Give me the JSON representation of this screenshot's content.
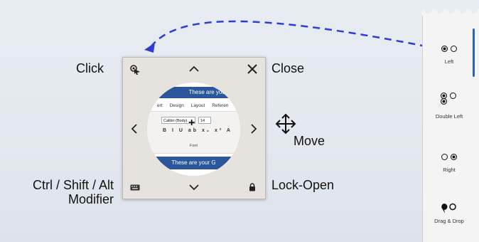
{
  "annotations": {
    "click": "Click",
    "close": "Close",
    "move": "Move",
    "modifier_line1": "Ctrl / Shift / Alt",
    "modifier_line2": "Modifier",
    "lock_open": "Lock-Open"
  },
  "panel": {
    "icons": {
      "click": "pointer-click-icon",
      "up": "chevron-up-icon",
      "close": "close-icon",
      "left": "chevron-left-icon",
      "right": "chevron-right-icon",
      "down": "chevron-down-icon",
      "keyboard": "keyboard-icon",
      "lock": "lock-icon"
    },
    "lens": {
      "banner_top": "These are your",
      "tabs": [
        "ert",
        "Design",
        "Layout",
        "Referen"
      ],
      "font_name": "Calibri (Body)",
      "font_size": "14",
      "format_row": "B I U ab x₂ x² A",
      "group_label": "Font",
      "banner_bottom": "These are your G"
    }
  },
  "tool_strip": {
    "items": [
      {
        "label": "Left"
      },
      {
        "label": "Double Left"
      },
      {
        "label": "Right"
      },
      {
        "label": "Drag & Drop"
      }
    ],
    "accent": "#2b63c9"
  },
  "colors": {
    "arrow": "#2e3fd0",
    "ribbon_blue": "#2b579a"
  }
}
